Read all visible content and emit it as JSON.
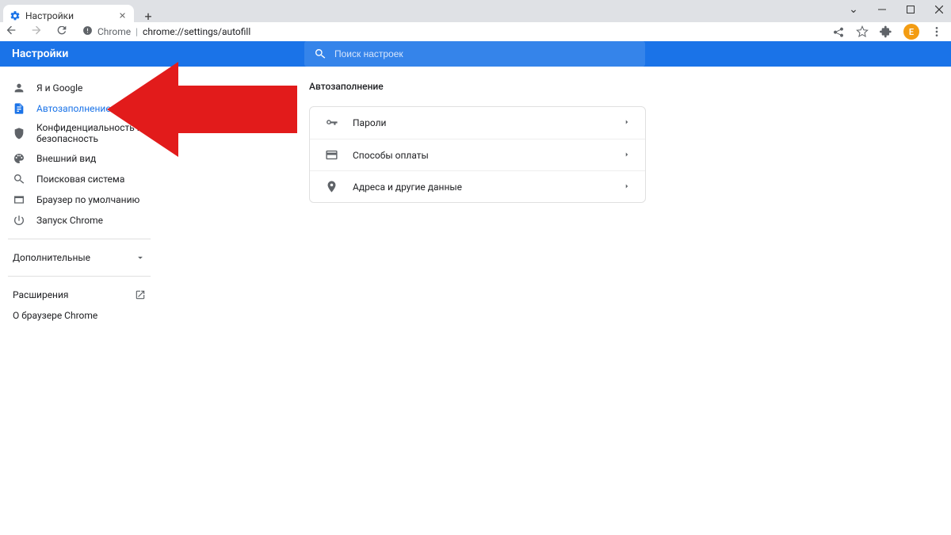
{
  "window": {
    "tab_title": "Настройки",
    "url_scheme_label": "Chrome",
    "url_path": "chrome://settings/autofill",
    "avatar_initial": "E"
  },
  "header": {
    "title": "Настройки",
    "search_placeholder": "Поиск настроек"
  },
  "sidebar": {
    "items": [
      {
        "id": "me-google",
        "label": "Я и Google"
      },
      {
        "id": "autofill",
        "label": "Автозаполнение"
      },
      {
        "id": "privacy",
        "label": "Конфиденциальность и безопасность"
      },
      {
        "id": "appearance",
        "label": "Внешний вид"
      },
      {
        "id": "search",
        "label": "Поисковая система"
      },
      {
        "id": "default",
        "label": "Браузер по умолчанию"
      },
      {
        "id": "startup",
        "label": "Запуск Chrome"
      }
    ],
    "advanced_label": "Дополнительные",
    "extensions_label": "Расширения",
    "about_label": "О браузере Chrome",
    "selected": "autofill"
  },
  "main": {
    "section_title": "Автозаполнение",
    "rows": [
      {
        "id": "passwords",
        "label": "Пароли"
      },
      {
        "id": "payments",
        "label": "Способы оплаты"
      },
      {
        "id": "addresses",
        "label": "Адреса и другие данные"
      }
    ]
  }
}
